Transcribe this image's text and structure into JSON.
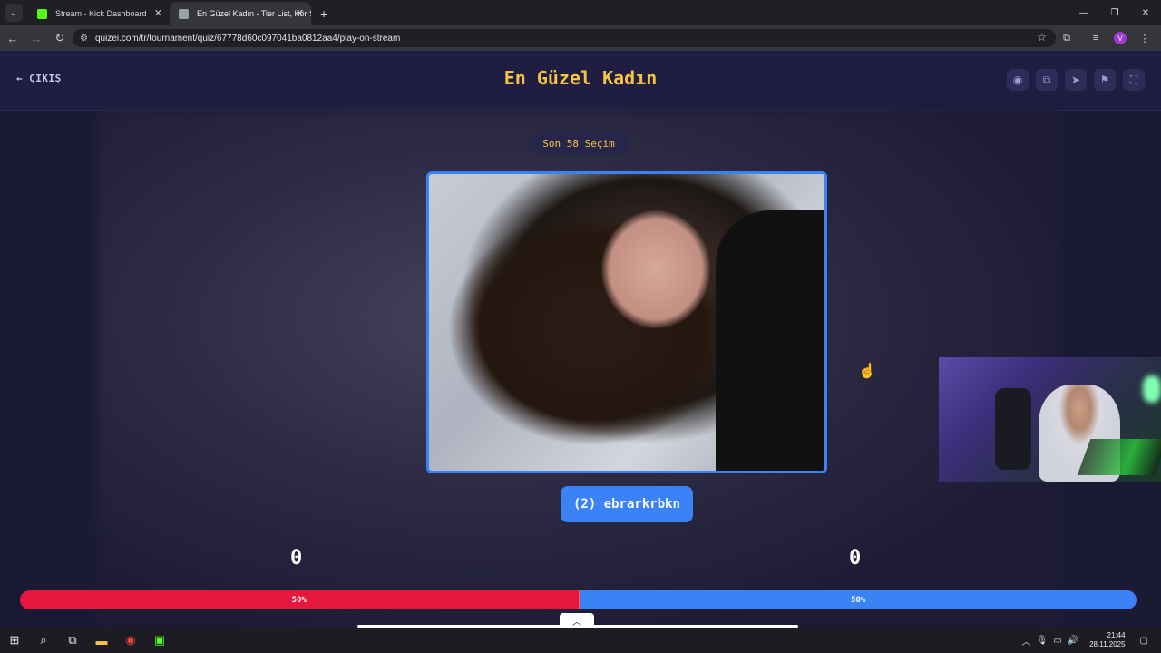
{
  "browser": {
    "tabs": [
      {
        "title": "Stream - Kick Dashboard",
        "favicon_color": "#53fc18",
        "active": false
      },
      {
        "title": "En Güzel Kadın - Tier List, Kör S",
        "favicon_color": "#9aa0a6",
        "active": true
      }
    ],
    "url": "quizei.com/tr/tournament/quiz/67778d60c097041ba0812aa4/play-on-stream",
    "profile_initial": "V"
  },
  "header": {
    "exit_label": "ÇIKIŞ",
    "title": "En Güzel Kadın",
    "icons": [
      "eye-icon",
      "share-icon",
      "send-icon",
      "flag-icon",
      "fullscreen-icon"
    ]
  },
  "game": {
    "round_badge": "Son 58 Seçim",
    "candidate_name": "(2) ebrarkrbkn",
    "score_left": "0",
    "score_right": "0",
    "vote_left_percent": "50%",
    "vote_right_percent": "50%",
    "colors": {
      "left": "#e5173f",
      "right": "#3b82f6",
      "title": "#f5c542"
    }
  },
  "taskbar": {
    "time": "21:44",
    "date": "28.11.2025"
  }
}
